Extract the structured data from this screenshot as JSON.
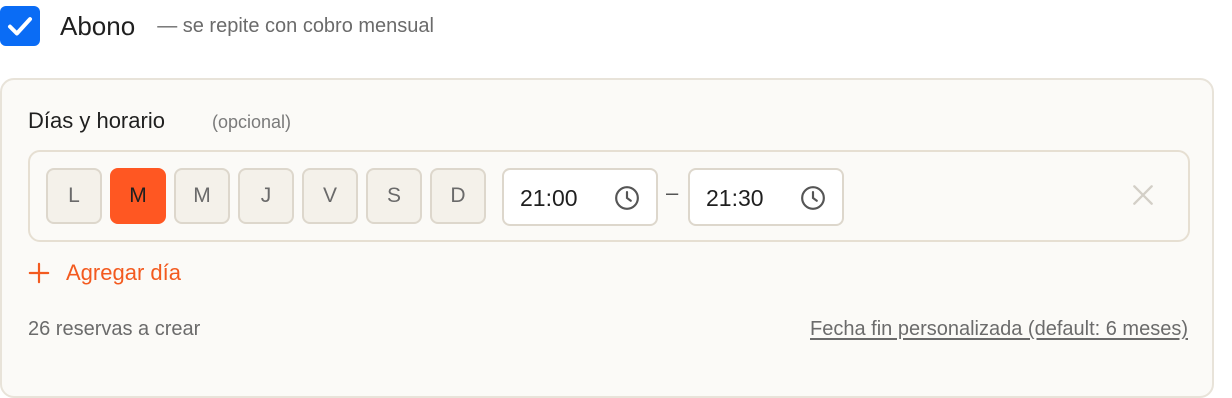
{
  "abono": {
    "checked": true,
    "label": "Abono",
    "hint": "— se repite con cobro mensual"
  },
  "schedule": {
    "title": "Días y horario",
    "optional": "(opcional)",
    "days": [
      {
        "label": "L",
        "selected": false
      },
      {
        "label": "M",
        "selected": true
      },
      {
        "label": "M",
        "selected": false
      },
      {
        "label": "J",
        "selected": false
      },
      {
        "label": "V",
        "selected": false
      },
      {
        "label": "S",
        "selected": false
      },
      {
        "label": "D",
        "selected": false
      }
    ],
    "start_time": "21:00",
    "separator": "–",
    "end_time": "21:30",
    "clock_icon": "clock-icon",
    "remove_icon": "close-icon"
  },
  "add_day": {
    "label": "Agregar día",
    "icon": "plus-icon"
  },
  "footer": {
    "count_text": "26 reservas a crear",
    "end_date_link": "Fecha fin personalizada (default: 6 meses)"
  },
  "colors": {
    "checkbox": "#0a6cf5",
    "accent": "#ff5722",
    "link_accent": "#f35a1f"
  }
}
